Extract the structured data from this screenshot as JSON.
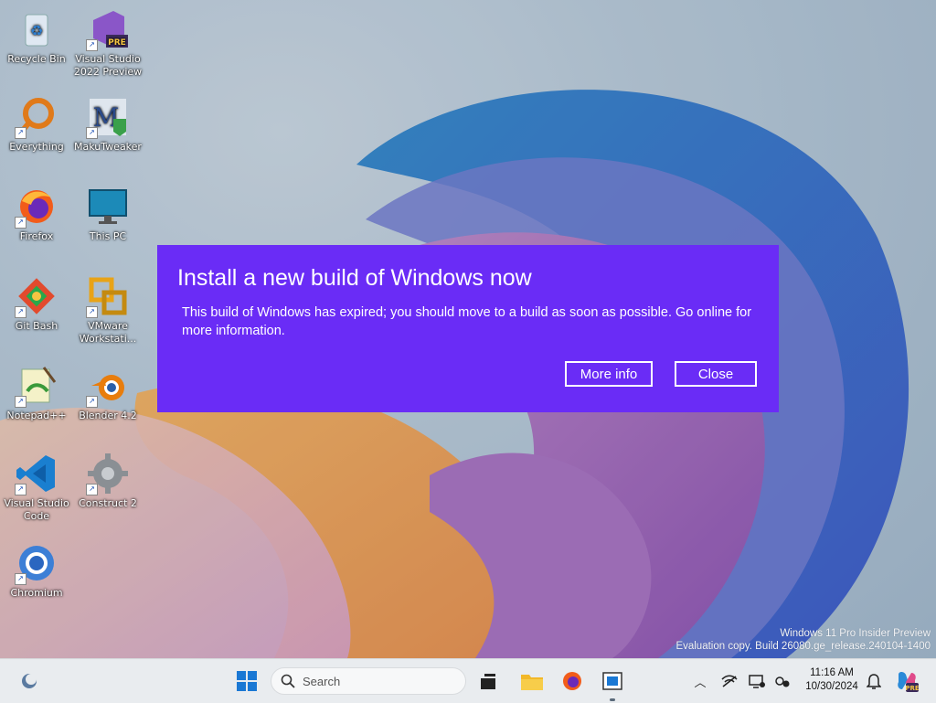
{
  "desktop": {
    "icons": [
      {
        "label": "Recycle Bin",
        "icon": "recycle-bin-icon"
      },
      {
        "label": "Visual Studio 2022 Preview",
        "icon": "visual-studio-preview-icon",
        "badge": "PRE"
      },
      {
        "label": "Everything",
        "icon": "everything-search-icon"
      },
      {
        "label": "MakuTweaker",
        "icon": "makutweaker-icon"
      },
      {
        "label": "Firefox",
        "icon": "firefox-icon"
      },
      {
        "label": "This PC",
        "icon": "monitor-icon"
      },
      {
        "label": "Git Bash",
        "icon": "git-bash-icon"
      },
      {
        "label": "VMware Workstati...",
        "icon": "vmware-icon"
      },
      {
        "label": "Notepad++",
        "icon": "notepad-plus-plus-icon"
      },
      {
        "label": "Blender 4.2",
        "icon": "blender-icon"
      },
      {
        "label": "Visual Studio Code",
        "icon": "vscode-icon"
      },
      {
        "label": "Construct 2",
        "icon": "construct2-icon"
      },
      {
        "label": "Chromium",
        "icon": "chromium-icon"
      }
    ]
  },
  "toast": {
    "title": "Install a new build of Windows now",
    "message": "This build of Windows has expired; you should move to a build as soon as possible. Go online for more information.",
    "more_info_label": "More info",
    "close_label": "Close",
    "background": "#6a2cf6"
  },
  "watermark": {
    "line1": "Windows 11 Pro Insider Preview",
    "line2": "Evaluation copy. Build 26080.ge_release.240104-1400"
  },
  "taskbar": {
    "search_placeholder": "Search",
    "time": "11:16 AM",
    "date": "10/30/2024",
    "pinned": [
      "start-icon",
      "task-view-icon",
      "file-explorer-icon",
      "firefox-icon",
      "active-window-icon"
    ],
    "tray": [
      "chevron-up-icon",
      "network-icon",
      "display-icon",
      "vpn-icon",
      "notification-bell-icon",
      "copilot-icon"
    ]
  }
}
